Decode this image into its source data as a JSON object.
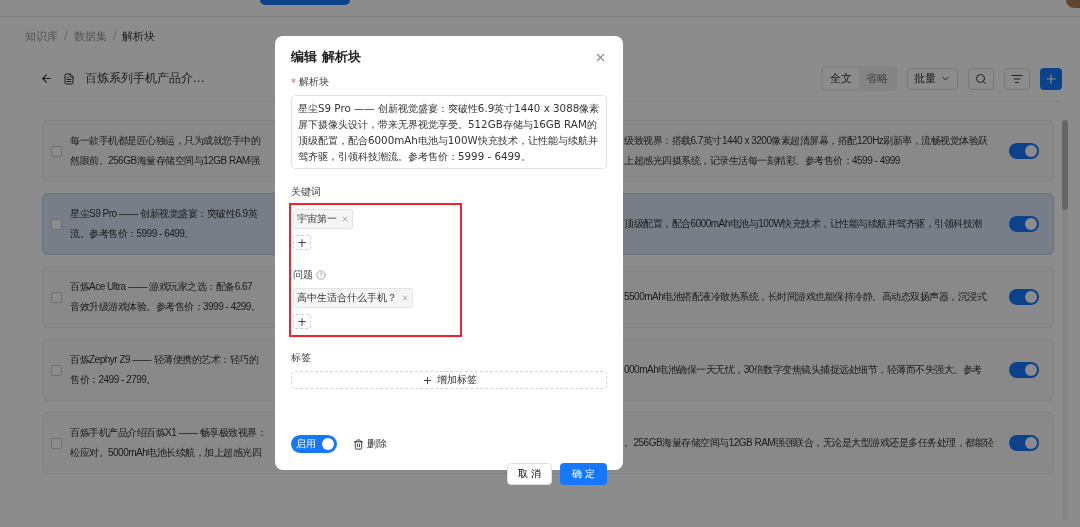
{
  "breadcrumb_separator": "/",
  "breadcrumb": [
    {
      "label": "知识库",
      "current": false
    },
    {
      "label": "数据集",
      "current": false
    },
    {
      "label": "解析块",
      "current": true
    }
  ],
  "toolbar": {
    "document": "百炼系列手机产品介...",
    "view_modes": [
      {
        "label": "全文",
        "selected": true
      },
      {
        "label": "省略",
        "selected": false
      }
    ],
    "batch": "批量"
  },
  "chunks": [
    {
      "selected": false,
      "on": true,
      "left": [
        "每一款手机都是匠心独运，只为成就您手中的",
        "然眼前。256GB海量存储空间与12GB RAM强"
      ],
      "right": [
        "级致视界：搭载6.7英寸1440 x 3200像素超清屏幕，搭配120Hz刷新率，流畅视觉体验跃",
        "上超感光四摄系统，记录生活每一刻精彩。参考售价：4599 - 4999"
      ]
    },
    {
      "selected": true,
      "on": true,
      "left": [
        "星尘S9 Pro —— 创新视觉盛宴：突破性6.9英",
        "流。参考售价：5999 - 6499。"
      ],
      "right": [
        "顶级配置，配合6000mAh电池与100W快充技术，让性能与续航并驾齐驱，引领科技潮"
      ]
    },
    {
      "selected": false,
      "on": true,
      "left": [
        "百炼Ace Ultra —— 游戏玩家之选：配备6.67",
        "音效升级游戏体验。参考售价：3999 - 4299。"
      ],
      "right": [
        "5500mAh电池搭配液冷散热系统，长时间游戏也能保持冷静。高动态双扬声器，沉浸式"
      ]
    },
    {
      "selected": false,
      "on": true,
      "left": [
        "百炼Zephyr Z9 —— 轻薄便携的艺术：轻巧的",
        "售价：2499 - 2799。"
      ],
      "right": [
        "000mAh电池确保一天无忧，30倍数字变焦镜头捕捉远处细节，轻薄而不失强大。参考"
      ]
    },
    {
      "selected": false,
      "on": true,
      "left": [
        "百炼手机产品介绍百炼X1 —— 畅享极致视界：",
        "松应对。5000mAh电池长续航，加上超感光四"
      ],
      "right": [
        "。256GB海量存储空间与12GB RAM强强联合，无论是大型游戏还是多任务处理，都能轻"
      ]
    }
  ],
  "dialog": {
    "title": "编辑 解析块",
    "required_mark": "*",
    "content_label": "解析块",
    "content": "星尘S9 Pro —— 创新视觉盛宴：突破性6.9英寸1440 x 3088像素屏下摄像头设计，带来无界视觉享受。512GB存储与16GB RAM的顶级配置，配合6000mAh电池与100W快充技术，让性能与续航并驾齐驱，引领科技潮流。参考售价：5999 - 6499。",
    "keywords_label": "关键词",
    "keywords": [
      "宇宙第一"
    ],
    "add_keyword": "+",
    "questions_label": "问题",
    "questions": [
      "高中生适合什么手机？"
    ],
    "add_question": "+",
    "tags_label": "标签",
    "add_tag": "增加标签",
    "enabled": {
      "label": "启用",
      "on": true
    },
    "delete": "删除",
    "cancel": "取 消",
    "ok": "确 定"
  }
}
